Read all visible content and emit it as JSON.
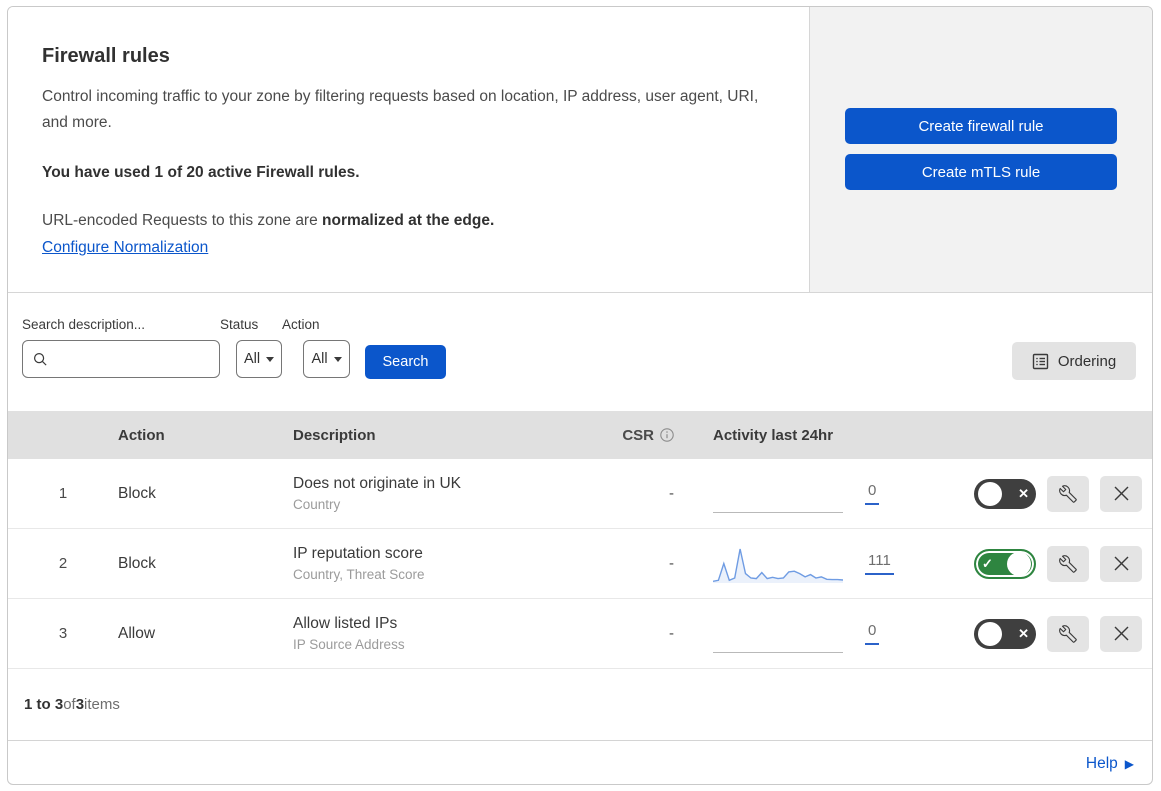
{
  "header": {
    "title": "Firewall rules",
    "description": "Control incoming traffic to your zone by filtering requests based on location, IP address, user agent, URI, and more.",
    "usage_notice": "You have used 1 of 20 active Firewall rules.",
    "normalization_prefix": "URL-encoded Requests to this zone are ",
    "normalization_bold": "normalized at the edge.",
    "normalization_link": "Configure Normalization"
  },
  "aside": {
    "create_firewall_rule_label": "Create firewall rule",
    "create_mtls_rule_label": "Create mTLS rule"
  },
  "filters": {
    "search_label": "Search description...",
    "search_value": "",
    "status_label": "Status",
    "status_value": "All",
    "action_label": "Action",
    "action_value": "All",
    "search_button_label": "Search",
    "ordering_button_label": "Ordering"
  },
  "table": {
    "headers": {
      "action": "Action",
      "description": "Description",
      "csr": "CSR",
      "activity": "Activity last 24hr"
    },
    "rows": [
      {
        "index": "1",
        "action": "Block",
        "description": "Does not originate in UK",
        "criteria": "Country",
        "csr": "-",
        "activity_count": "0",
        "enabled": false,
        "sparkline": []
      },
      {
        "index": "2",
        "action": "Block",
        "description": "IP reputation score",
        "criteria": "Country, Threat Score",
        "csr": "-",
        "activity_count": "111",
        "enabled": true,
        "sparkline": [
          2,
          5,
          55,
          5,
          12,
          98,
          25,
          12,
          10,
          28,
          10,
          14,
          10,
          12,
          30,
          32,
          25,
          15,
          22,
          12,
          15,
          8,
          7,
          7,
          6
        ]
      },
      {
        "index": "3",
        "action": "Allow",
        "description": "Allow listed IPs",
        "criteria": "IP Source Address",
        "csr": "-",
        "activity_count": "0",
        "enabled": false,
        "sparkline": []
      }
    ]
  },
  "footer": {
    "range": "1 to 3",
    "of": " of ",
    "total": "3",
    "items": " items"
  },
  "help": {
    "label": "Help"
  },
  "colors": {
    "accent_blue": "#0b56cb",
    "toggle_on_green": "#2e8540",
    "toggle_off_gray": "#3f3f3f",
    "sparkline_blue": "#6f9ce3",
    "count_underline_blue": "#2b62c9",
    "aside_gray": "#f2f2f2",
    "table_header_gray": "#e0e0e0"
  }
}
